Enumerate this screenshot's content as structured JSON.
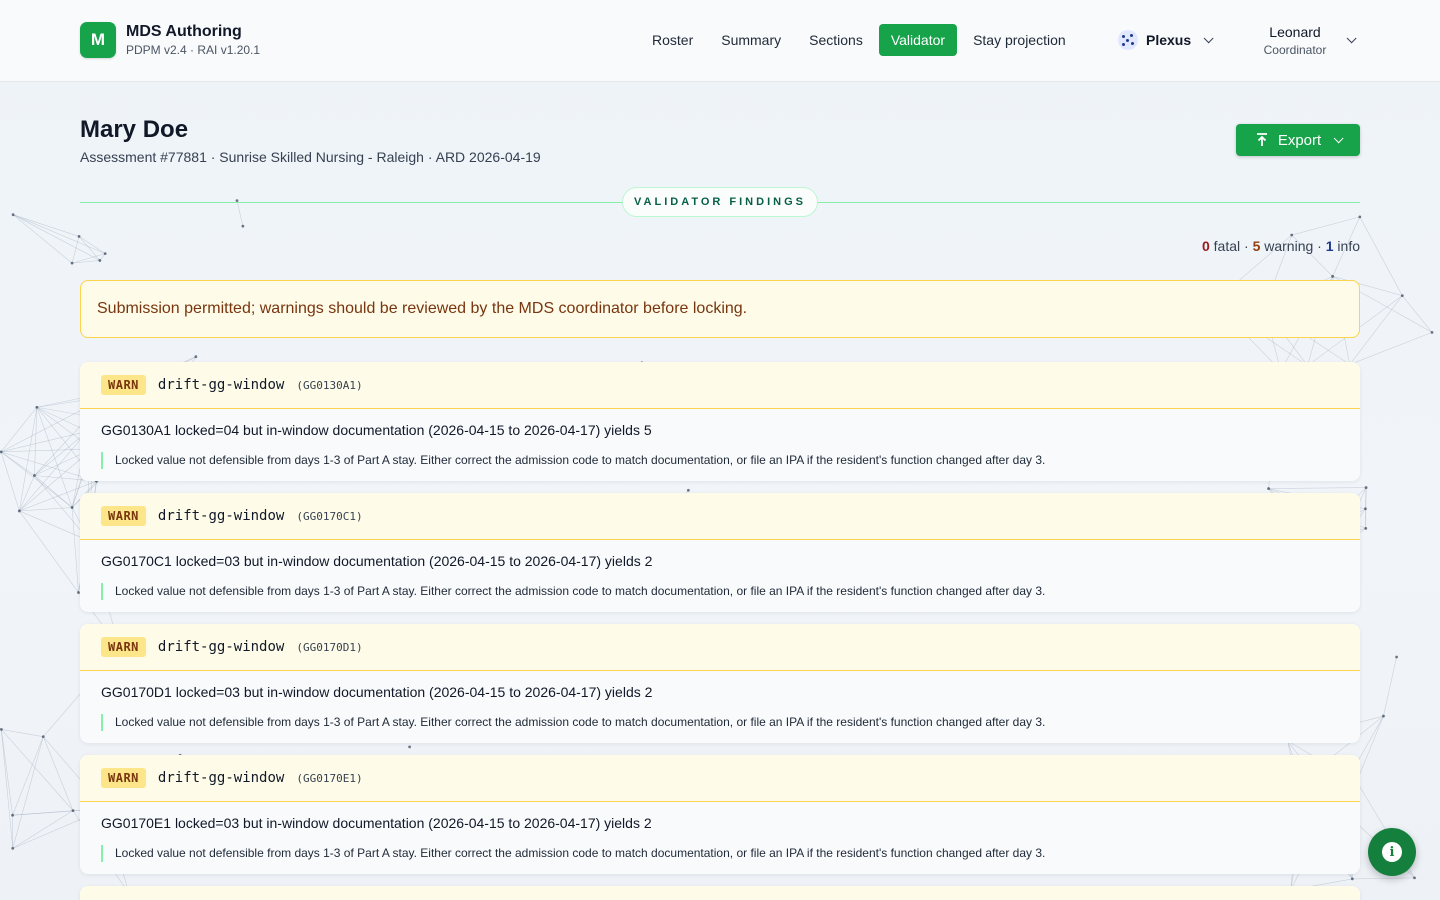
{
  "app": {
    "logo_letter": "M",
    "title": "MDS Authoring",
    "version": "PDPM v2.4 · RAI v1.20.1"
  },
  "nav": {
    "items": [
      {
        "label": "Roster"
      },
      {
        "label": "Summary"
      },
      {
        "label": "Sections"
      },
      {
        "label": "Validator",
        "active": true
      },
      {
        "label": "Stay projection"
      }
    ]
  },
  "org_switcher": {
    "label": "Plexus",
    "icon": "plexus-logo-icon"
  },
  "user": {
    "name": "Leonard",
    "role": "Coordinator"
  },
  "patient": {
    "name": "Mary Doe",
    "meta": "Assessment #77881 · Sunrise Skilled Nursing - Raleigh · ARD 2026-04-19"
  },
  "export_button": {
    "label": "Export",
    "icon": "export-icon"
  },
  "section_title": "VALIDATOR FINDINGS",
  "counts": {
    "fatal": "0",
    "fatal_label": "fatal ·",
    "warning": "5",
    "warning_label": "warning ·",
    "info": "1",
    "info_label": "info"
  },
  "banner": {
    "text": "Submission permitted; warnings should be reviewed by the MDS coordinator before locking."
  },
  "findings": [
    {
      "severity": "WARN",
      "rule": "drift-gg-window",
      "code": "(GG0130A1)",
      "message": "GG0130A1 locked=04 but in-window documentation (2026-04-15 to 2026-04-17) yields 5",
      "note": "Locked value not defensible from days 1-3 of Part A stay. Either correct the admission code to match documentation, or file an IPA if the resident's function changed after day 3."
    },
    {
      "severity": "WARN",
      "rule": "drift-gg-window",
      "code": "(GG0170C1)",
      "message": "GG0170C1 locked=03 but in-window documentation (2026-04-15 to 2026-04-17) yields 2",
      "note": "Locked value not defensible from days 1-3 of Part A stay. Either correct the admission code to match documentation, or file an IPA if the resident's function changed after day 3."
    },
    {
      "severity": "WARN",
      "rule": "drift-gg-window",
      "code": "(GG0170D1)",
      "message": "GG0170D1 locked=03 but in-window documentation (2026-04-15 to 2026-04-17) yields 2",
      "note": "Locked value not defensible from days 1-3 of Part A stay. Either correct the admission code to match documentation, or file an IPA if the resident's function changed after day 3."
    },
    {
      "severity": "WARN",
      "rule": "drift-gg-window",
      "code": "(GG0170E1)",
      "message": "GG0170E1 locked=03 but in-window documentation (2026-04-15 to 2026-04-17) yields 2",
      "note": "Locked value not defensible from days 1-3 of Part A stay. Either correct the admission code to match documentation, or file an IPA if the resident's function changed after day 3."
    }
  ],
  "colors": {
    "accent": "#16a34a",
    "warn_bg": "#fefce8",
    "warn_border": "#fcd34d",
    "warn_badge": "#fde68a",
    "fatal": "#991b1b",
    "info": "#1e3a8a"
  },
  "fab": {
    "icon": "info-icon"
  }
}
